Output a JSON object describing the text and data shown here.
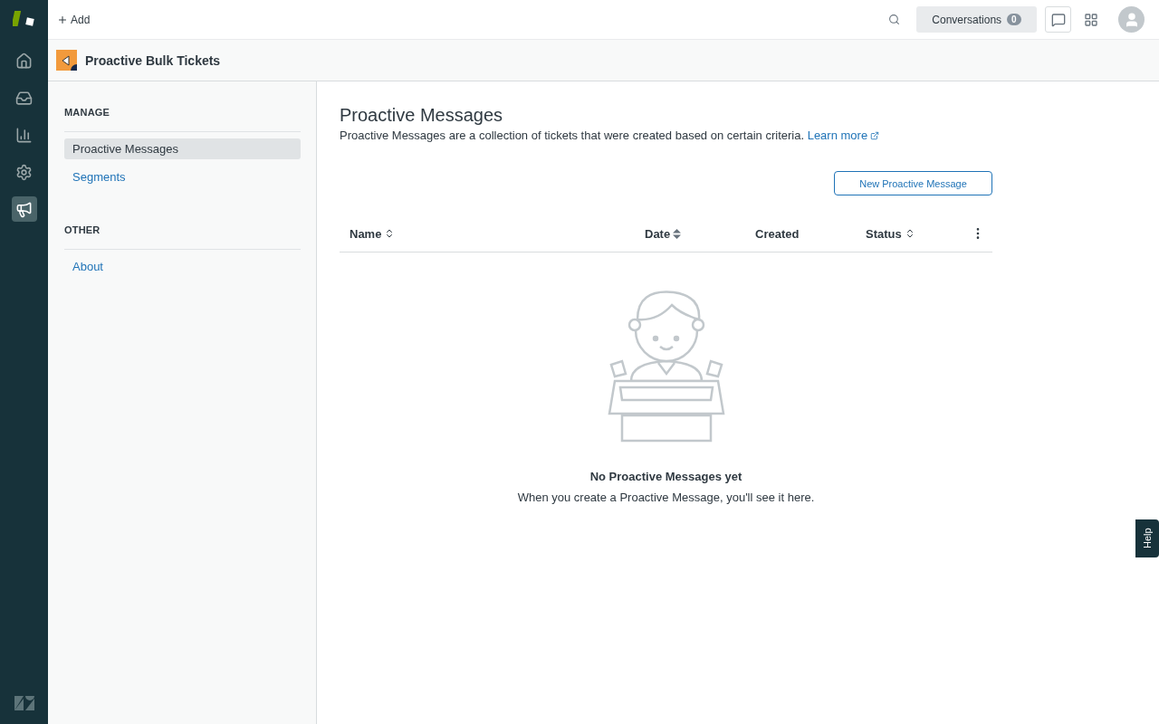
{
  "rail": {
    "items": [
      {
        "selected": false
      },
      {
        "selected": false
      },
      {
        "selected": false
      },
      {
        "selected": false
      },
      {
        "selected": true
      }
    ]
  },
  "topbar": {
    "add_label": "Add",
    "conversations": {
      "label": "Conversations",
      "count": "0"
    }
  },
  "app_header": {
    "title": "Proactive Bulk Tickets"
  },
  "sidebar": {
    "sections": [
      {
        "heading": "MANAGE",
        "items": [
          {
            "label": "Proactive Messages",
            "selected": true
          },
          {
            "label": "Segments",
            "selected": false
          }
        ]
      },
      {
        "heading": "OTHER",
        "items": [
          {
            "label": "About",
            "selected": false
          }
        ]
      }
    ]
  },
  "page": {
    "title": "Proactive Messages",
    "description": "Proactive Messages are a collection of tickets that were created based on certain criteria.",
    "link": "Learn more",
    "new_button": "New Proactive Message"
  },
  "table": {
    "columns": [
      {
        "label": "Name",
        "kind": "sortable"
      },
      {
        "label": "Date",
        "kind": "sorted"
      },
      {
        "label": "Created",
        "kind": "plain"
      },
      {
        "label": "Status",
        "kind": "sortable"
      }
    ]
  },
  "empty_state": {
    "title": "No Proactive Messages yet",
    "message": "When you create a Proactive Message, you'll see it here."
  },
  "help_tab": "Help"
}
